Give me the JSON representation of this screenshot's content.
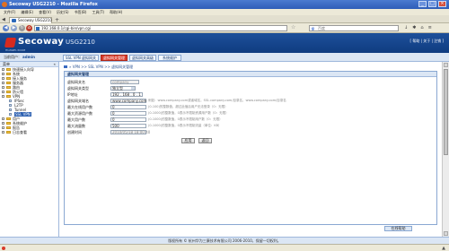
{
  "window": {
    "title": "Secoway USG2210 - Mozilla Firefox",
    "buttons": [
      "_",
      "□",
      "×"
    ]
  },
  "menu": [
    "文件(F)",
    "编辑(E)",
    "查看(V)",
    "历史(S)",
    "书签(B)",
    "工具(T)",
    "帮助(H)"
  ],
  "browser_tab": {
    "label": "Secoway USG2210",
    "new_tab": "+",
    "nav": "◀"
  },
  "address": {
    "url": "192.168.0.1/cgi-bin/vpn.cgi",
    "search_placeholder": "百度",
    "search_engine_glyph": "g"
  },
  "banner": {
    "brand": "Secoway",
    "model": "USG2210",
    "links": "[ 帮助 | 关于 | 注销 ]",
    "subtitle": "HUAWEI-3COM"
  },
  "subnav": {
    "current_user_label": "当前用户：",
    "current_user": "admin",
    "tabs": [
      "SSL VPN 虚拟网关",
      "虚拟网关管理",
      "虚拟网关高级",
      "系统维护"
    ],
    "active_tab": 1
  },
  "sidebar": {
    "header": "菜单",
    "header_toggle": "«",
    "items": [
      {
        "label": "快速接入向导",
        "level": 0,
        "type": "folder"
      },
      {
        "label": "系统",
        "level": 0,
        "type": "folder"
      },
      {
        "label": "接入服务",
        "level": 0,
        "type": "folder"
      },
      {
        "label": "服务器",
        "level": 0,
        "type": "folder"
      },
      {
        "label": "路由",
        "level": 0,
        "type": "folder"
      },
      {
        "label": "防火墙",
        "level": 0,
        "type": "folder"
      },
      {
        "label": "VPN",
        "level": 0,
        "type": "folder"
      },
      {
        "label": "IPSec",
        "level": 1,
        "type": "page"
      },
      {
        "label": "L2TP",
        "level": 1,
        "type": "page"
      },
      {
        "label": "Tunnel",
        "level": 1,
        "type": "page"
      },
      {
        "label": "SSL VPN",
        "level": 1,
        "type": "page",
        "selected": true
      },
      {
        "label": "用户",
        "level": 0,
        "type": "folder"
      },
      {
        "label": "系统维护",
        "level": 0,
        "type": "folder"
      },
      {
        "label": "报告",
        "level": 0,
        "type": "folder"
      },
      {
        "label": "日志查看",
        "level": 0,
        "type": "folder"
      }
    ]
  },
  "breadcrumb": "» VPN >> SSL VPN >> 虚拟网关管理",
  "panel": {
    "title": "虚拟网关管理",
    "fields": [
      {
        "label": "虚拟网关名",
        "value": "company",
        "readonly": true,
        "hint": ""
      },
      {
        "label": "虚拟网关类型",
        "value": "独立型",
        "select": true,
        "hint": ""
      },
      {
        "label": "IP地址",
        "value": "192 . 168 . 0 . 1",
        "hint": ""
      },
      {
        "label": "虚拟网关域名",
        "value": "www.company.com",
        "hint": "例如：www.company.com或者域名，SSL.company.com/目录名，www.company.com/目录名"
      },
      {
        "label": "最大在线用户数",
        "value": "0",
        "hint": "(0-100)的整数值，超过此值后用户无法登录（0：无限）"
      },
      {
        "label": "最大资源用户数",
        "value": "0",
        "hint": "(0-1000)的整数值，0表示不限制资源用户数（0：无限）"
      },
      {
        "label": "最大用户数",
        "value": "0",
        "hint": "(0-1000)的整数值，0表示不限制用户数（0：无限）"
      },
      {
        "label": "最大流量数",
        "value": "500",
        "hint": "(0-1000)的整数值，0表示不限制流量（单位：KB）"
      },
      {
        "label": "创建时间",
        "value": "2010/05/18 18:00:40",
        "readonly": true,
        "hint": ""
      }
    ],
    "apply": "应用",
    "back": "返回"
  },
  "help_button": "在线帮助",
  "footer": "版权所有 © 杭州华为三康技术有限公司 2006-2010，保留一切权利。",
  "status_icon": "▲"
}
